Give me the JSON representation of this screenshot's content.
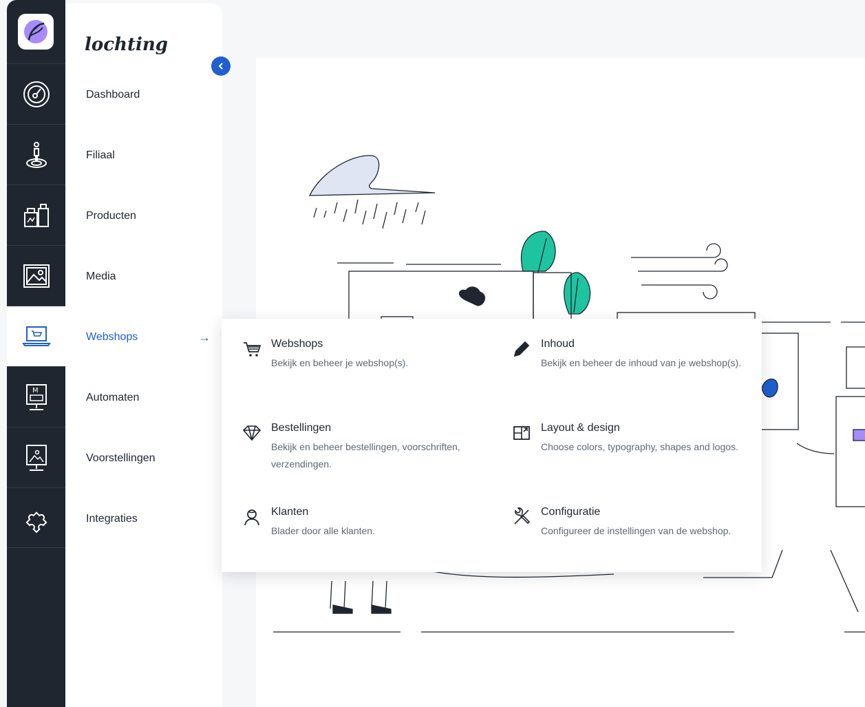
{
  "brand": {
    "name": "lochting"
  },
  "rail": {
    "items": [
      {
        "icon": "dashboard-gauge-icon"
      },
      {
        "icon": "branch-person-icon"
      },
      {
        "icon": "products-bottles-icon"
      },
      {
        "icon": "media-image-icon"
      },
      {
        "icon": "webshop-laptop-cart-icon",
        "active": true
      },
      {
        "icon": "vending-machine-icon"
      },
      {
        "icon": "presentation-board-icon"
      },
      {
        "icon": "integrations-puzzle-icon"
      }
    ]
  },
  "nav": {
    "items": [
      {
        "label": "Dashboard"
      },
      {
        "label": "Filiaal"
      },
      {
        "label": "Producten"
      },
      {
        "label": "Media"
      },
      {
        "label": "Webshops",
        "active": true
      },
      {
        "label": "Automaten"
      },
      {
        "label": "Voorstellingen"
      },
      {
        "label": "Integraties"
      }
    ],
    "active_arrow": "→",
    "collapse_icon": "chevron-left-icon"
  },
  "dropdown": {
    "items": [
      {
        "title": "Webshops",
        "desc": "Bekijk en beheer je webshop(s).",
        "icon": "cart-icon"
      },
      {
        "title": "Inhoud",
        "desc": "Bekijk en beheer de inhoud van je webshop(s).",
        "icon": "pencil-icon"
      },
      {
        "title": "Bestellingen",
        "desc": "Bekijk en beheer bestellingen, voorschriften, verzendingen.",
        "icon": "diamond-icon"
      },
      {
        "title": "Layout & design",
        "desc": "Choose colors, typography, shapes and logos.",
        "icon": "layout-icon"
      },
      {
        "title": "Klanten",
        "desc": "Blader door alle klanten.",
        "icon": "customer-icon"
      },
      {
        "title": "Configuratie",
        "desc": "Configureer de instellingen van de webshop.",
        "icon": "tools-icon"
      }
    ]
  },
  "colors": {
    "accent": "#1f5fce",
    "rail": "#1f2630",
    "leaf": "#1ec4a0",
    "brand_purple": "#a78bfa"
  }
}
